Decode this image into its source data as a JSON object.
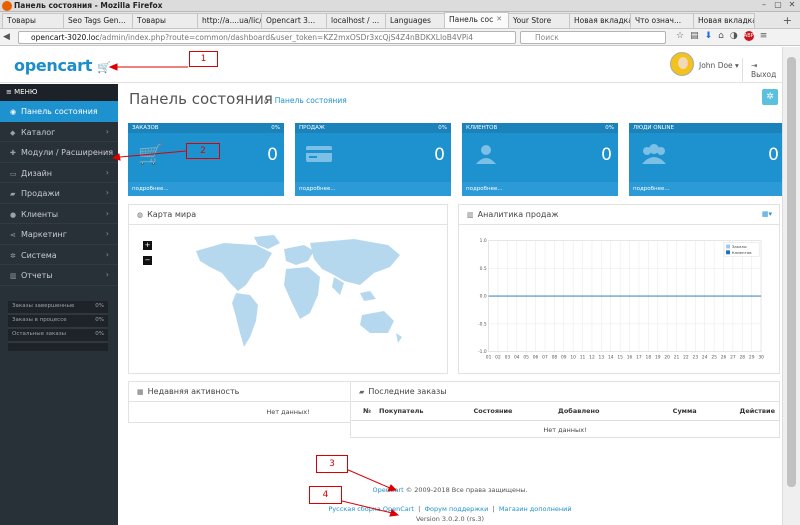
{
  "window": {
    "title": "Панель состояния - Mozilla Firefox"
  },
  "tabs": [
    {
      "label": "Товары"
    },
    {
      "label": "Seo Tags Gen..."
    },
    {
      "label": "Товары"
    },
    {
      "label": "http://a....ua/lic/"
    },
    {
      "label": "Opencart 3..."
    },
    {
      "label": "localhost / ..."
    },
    {
      "label": "Languages"
    },
    {
      "label": "Панель сос"
    },
    {
      "label": "Your Store"
    },
    {
      "label": "Новая вкладка"
    },
    {
      "label": "Что означ..."
    },
    {
      "label": "Новая вкладка"
    }
  ],
  "url": {
    "host": "opencart-3020.loc",
    "path": "/admin/index.php?route=common/dashboard&user_token=KZ2mxOSDr3xcQjS4Z4nBDKXLIoB4VPi4"
  },
  "search": {
    "placeholder": "Поиск"
  },
  "header": {
    "logo": "opencart",
    "user": "John Doe",
    "logout": "Выход"
  },
  "sidebar": {
    "menu_label": "МЕНЮ",
    "items": [
      {
        "label": "Панель состояния"
      },
      {
        "label": "Каталог"
      },
      {
        "label": "Модули / Расширения"
      },
      {
        "label": "Дизайн"
      },
      {
        "label": "Продажи"
      },
      {
        "label": "Клиенты"
      },
      {
        "label": "Маркетинг"
      },
      {
        "label": "Система"
      },
      {
        "label": "Отчеты"
      }
    ],
    "stats": [
      {
        "label": "Заказы завершенные",
        "value": "0%"
      },
      {
        "label": "Заказы в процессе",
        "value": "0%"
      },
      {
        "label": "Остальные заказы",
        "value": "0%"
      }
    ]
  },
  "page": {
    "title": "Панель состояния",
    "breadcrumb": "Панель состояния"
  },
  "tiles": [
    {
      "title": "ЗАКАЗОВ",
      "percent": "0%",
      "value": "0",
      "footer": "подробнее..."
    },
    {
      "title": "ПРОДАЖ",
      "percent": "0%",
      "value": "0",
      "footer": "подробнее..."
    },
    {
      "title": "КЛИЕНТОВ",
      "percent": "0%",
      "value": "0",
      "footer": "подробнее..."
    },
    {
      "title": "ЛЮДИ ONLINE",
      "percent": "",
      "value": "0",
      "footer": "подробнее..."
    }
  ],
  "map_panel": {
    "title": "Карта мира",
    "zoom_in": "+",
    "zoom_out": "−"
  },
  "sales_panel": {
    "title": "Аналитика продаж"
  },
  "chart_data": {
    "type": "line",
    "x": [
      "01",
      "02",
      "03",
      "04",
      "05",
      "06",
      "07",
      "08",
      "09",
      "10",
      "11",
      "12",
      "13",
      "14",
      "15",
      "16",
      "17",
      "18",
      "19",
      "20",
      "21",
      "22",
      "23",
      "24",
      "25",
      "26",
      "27",
      "28",
      "29",
      "30"
    ],
    "series": [
      {
        "name": "Заказы",
        "values": [
          0,
          0,
          0,
          0,
          0,
          0,
          0,
          0,
          0,
          0,
          0,
          0,
          0,
          0,
          0,
          0,
          0,
          0,
          0,
          0,
          0,
          0,
          0,
          0,
          0,
          0,
          0,
          0,
          0,
          0
        ]
      },
      {
        "name": "Клиентов",
        "values": [
          0,
          0,
          0,
          0,
          0,
          0,
          0,
          0,
          0,
          0,
          0,
          0,
          0,
          0,
          0,
          0,
          0,
          0,
          0,
          0,
          0,
          0,
          0,
          0,
          0,
          0,
          0,
          0,
          0,
          0
        ]
      }
    ],
    "ylim": [
      -1.0,
      1.0
    ],
    "yticks": [
      "1.0",
      "0.5",
      "0.0",
      "-0.5",
      "-1.0"
    ],
    "grid": true,
    "legend": "top-right",
    "colors": [
      "#9dc8ea",
      "#1e6fb9"
    ]
  },
  "activity_panel": {
    "title": "Недавняя активность",
    "empty": "Нет данных!"
  },
  "orders_panel": {
    "title": "Последние заказы",
    "columns": [
      "№",
      "Покупатель",
      "Состояние",
      "Добавлено",
      "Сумма",
      "Действие"
    ],
    "empty": "Нет данных!"
  },
  "footer": {
    "brand": "OpenCart",
    "copyright": "© 2009-2018 Все права защищены.",
    "links": [
      "Русская сборка OpenCart",
      "Форум поддержки",
      "Магазин дополнений"
    ],
    "separator": "|",
    "version": "Version 3.0.2.0 (rs.3)"
  },
  "annotations": [
    "1",
    "2",
    "3",
    "4"
  ],
  "colors": {
    "accent": "#1e91cf",
    "sidebar": "#283038",
    "annotation": "#d00000"
  }
}
